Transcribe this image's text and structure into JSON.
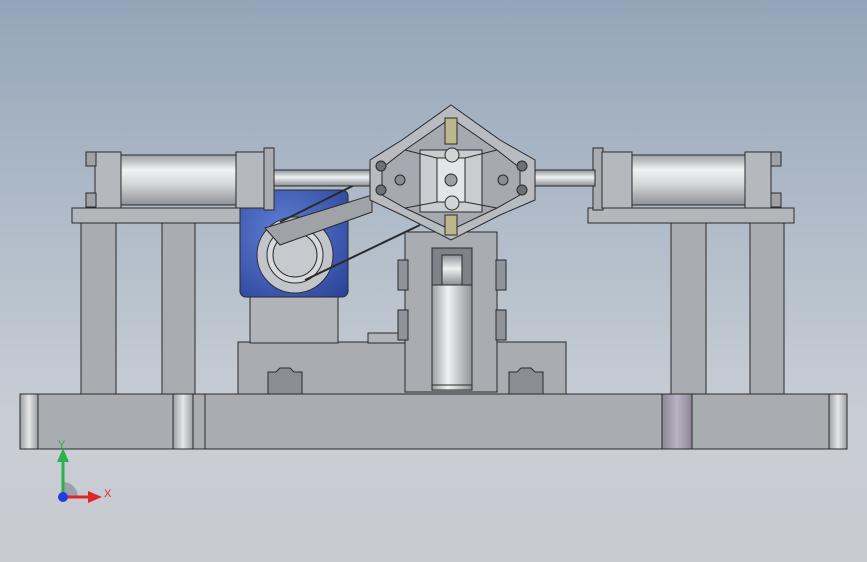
{
  "triad": {
    "x_label": "X",
    "y_label": "Y",
    "x_color": "#e0262b",
    "y_color": "#29b14a",
    "z_color": "#1f3fe0"
  },
  "colors": {
    "background_top": "#95a5b9",
    "background_bottom": "#c8cbd0",
    "steel": "#a9acb1",
    "motor_blue": "#3b59b6",
    "cylinder": "#d8dadd",
    "outline": "#2a2a2a"
  }
}
